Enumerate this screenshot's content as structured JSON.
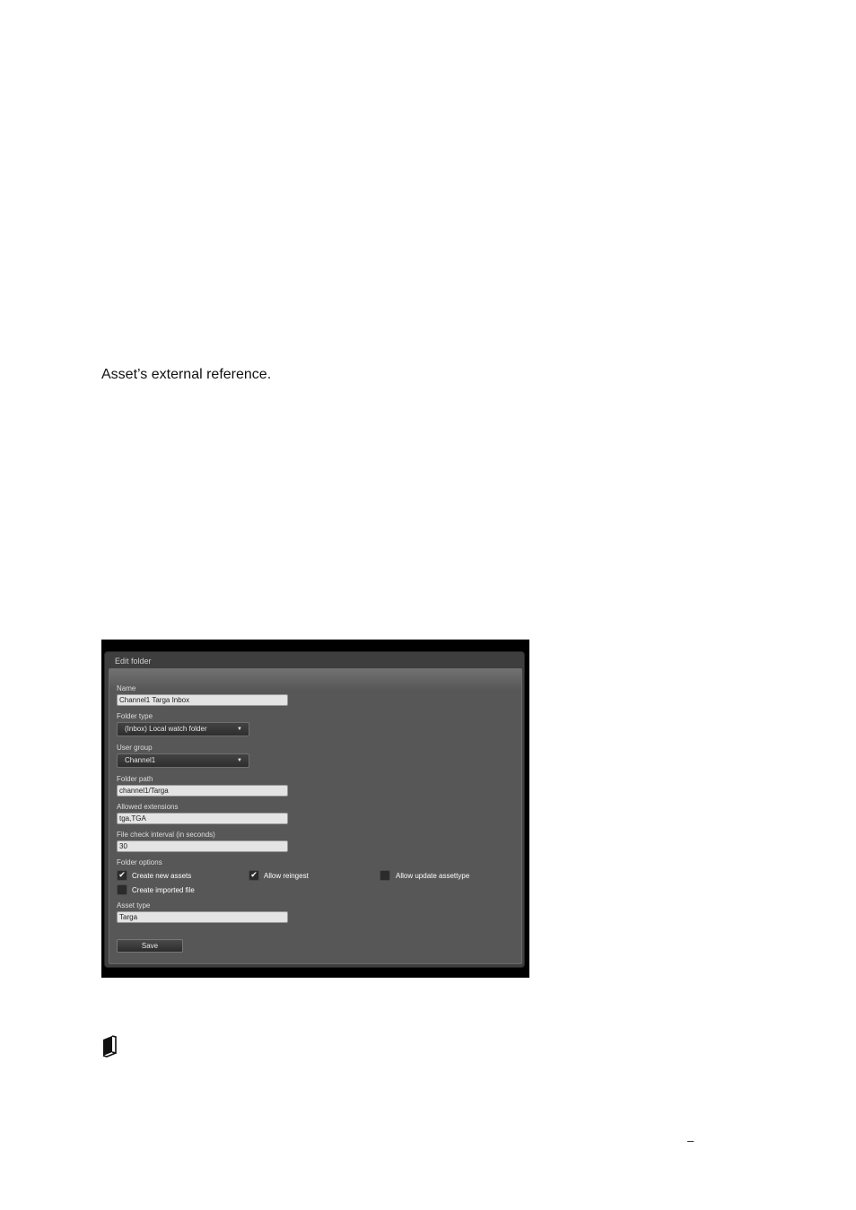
{
  "document": {
    "paragraph": "Asset’s external reference.",
    "page_mark": "–"
  },
  "dialog": {
    "title": "Edit folder",
    "fields": {
      "name": {
        "label": "Name",
        "value": "Channel1 Targa Inbox"
      },
      "folder_type": {
        "label": "Folder type",
        "value": "(Inbox) Local watch folder"
      },
      "user_group": {
        "label": "User group",
        "value": "Channel1"
      },
      "folder_path": {
        "label": "Folder path",
        "value": "channel1/Targa"
      },
      "allowed_extensions": {
        "label": "Allowed extensions",
        "value": "tga,TGA"
      },
      "file_check_interval": {
        "label": "File check interval (in seconds)",
        "value": "30"
      },
      "asset_type": {
        "label": "Asset type",
        "value": "Targa"
      }
    },
    "folder_options": {
      "label": "Folder options",
      "items": [
        {
          "label": "Create new assets",
          "checked": true
        },
        {
          "label": "Allow reingest",
          "checked": true
        },
        {
          "label": "Allow update assettype",
          "checked": false
        },
        {
          "label": "Create imported file",
          "checked": false
        }
      ]
    },
    "save_label": "Save",
    "check_glyph": "✔",
    "caret_glyph": "▼"
  },
  "icons": {
    "note": "book-icon"
  },
  "colors": {
    "screenshot_bg": "#000000",
    "dialog_bg": "#3e3e3e",
    "panel_bg": "#575757",
    "field_bg": "#e4e4e4",
    "label_text": "#dddddd"
  }
}
